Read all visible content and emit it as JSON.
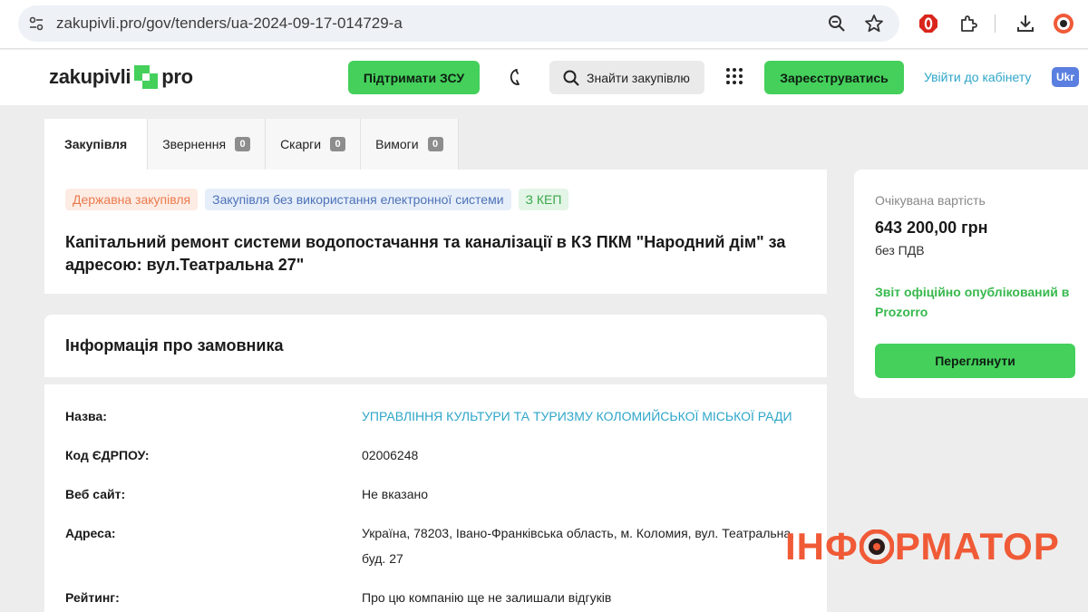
{
  "browser": {
    "url": "zakupivli.pro/gov/tenders/ua-2024-09-17-014729-a"
  },
  "header": {
    "logo_left": "zakupivli",
    "logo_right": "pro",
    "support_button": "Підтримати ЗСУ",
    "search_button": "Знайти закупівлю",
    "register_button": "Зареєструватись",
    "login_link": "Увійти до кабінету",
    "language": "Ukr"
  },
  "tabs": [
    {
      "label": "Закупівля",
      "count": ""
    },
    {
      "label": "Звернення",
      "count": "0"
    },
    {
      "label": "Скарги",
      "count": "0"
    },
    {
      "label": "Вимоги",
      "count": "0"
    }
  ],
  "tender": {
    "badges": [
      "Державна закупівля",
      "Закупівля без використання електронної системи",
      "З КЕП"
    ],
    "title": "Капітальний ремонт системи водопостачання та каналізації в КЗ ПКМ \"Народний дім\" за адресою: вул.Театральна 27\""
  },
  "customer": {
    "heading": "Інформація про замовника",
    "rows": [
      {
        "label": "Назва:",
        "value": "УПРАВЛІННЯ КУЛЬТУРИ ТА ТУРИЗМУ КОЛОМИЙСЬКОЇ МІСЬКОЇ РАДИ"
      },
      {
        "label": "Код ЄДРПОУ:",
        "value": "02006248"
      },
      {
        "label": "Веб сайт:",
        "value": "Не вказано"
      },
      {
        "label": "Адреса:",
        "value": "Україна, 78203, Івано-Франківська область, м. Коломия, вул. Театральна, буд. 27"
      },
      {
        "label": "Рейтинг:",
        "value": "Про цю компанію ще не залишали відгуків"
      }
    ]
  },
  "side": {
    "expected_label": "Очікувана вартість",
    "expected_value": "643 200,00 грн",
    "vat_note": "без ПДВ",
    "report_text": "Звіт офіційно опублікований в Prozorro",
    "view_button": "Переглянути"
  },
  "watermark": {
    "left": "ІНФ",
    "right": "РМАТОР"
  },
  "colors": {
    "green": "#44d05b",
    "link": "#2ea6c9",
    "report": "#37b84d",
    "watermark": "#f05a37"
  }
}
